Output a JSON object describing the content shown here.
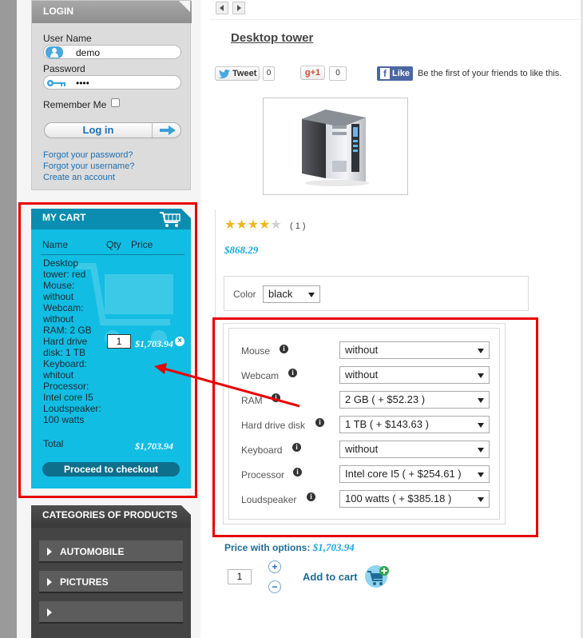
{
  "login": {
    "title": "LOGIN",
    "username_label": "User Name",
    "username_value": "demo",
    "password_label": "Password",
    "password_value": "••••",
    "remember_label": "Remember Me",
    "login_button": "Log in",
    "forgot_password": "Forgot your password?",
    "forgot_username": "Forgot your username?",
    "create_account": "Create an account"
  },
  "cart": {
    "title": "MY CART",
    "col_name": "Name",
    "col_qty": "Qty",
    "col_price": "Price",
    "item_lines": [
      "Desktop",
      "tower: red",
      "Mouse:",
      "without",
      "Webcam:",
      "without",
      "RAM: 2 GB",
      "Hard drive",
      "disk: 1 TB",
      "Keyboard:",
      "whitout",
      "Processor:",
      "Intel core I5",
      "Loudspeaker:",
      "100 watts"
    ],
    "item_qty": "1",
    "item_price": "$1,703.94",
    "total_label": "Total",
    "total_value": "$1,703.94",
    "checkout_button": "Proceed to checkout"
  },
  "categories": {
    "title": "CATEGORIES OF PRODUCTS",
    "items": [
      "AUTOMOBILE",
      "PICTURES",
      ""
    ]
  },
  "product": {
    "title": "Desktop tower",
    "tweet_label": "Tweet",
    "tweet_count": "0",
    "gplus_label": "+1",
    "gplus_count": "0",
    "fb_like_label": "Like",
    "fb_text": "Be the first of your friends to like this.",
    "rating_stars": 4,
    "rating_count": "( 1 )",
    "price": "$868.29",
    "color_label": "Color",
    "color_value": "black",
    "options": [
      {
        "label": "Mouse",
        "value": "without"
      },
      {
        "label": "Webcam",
        "value": "without"
      },
      {
        "label": "RAM",
        "value": "2 GB ( + $52.23 )"
      },
      {
        "label": "Hard drive disk",
        "value": "1 TB ( + $143.63 )"
      },
      {
        "label": "Keyboard",
        "value": "without"
      },
      {
        "label": "Processor",
        "value": "Intel core I5 ( + $254.61 )"
      },
      {
        "label": "Loudspeaker",
        "value": "100 watts ( + $385.18 )"
      }
    ],
    "price_with_options_label": "Price with options:",
    "price_with_options_value": "$1,703.94",
    "quantity": "1",
    "add_to_cart": "Add to cart"
  },
  "colors": {
    "highlight_border": "#e80000",
    "cart_bg": "#11bde3",
    "accent_blue": "#1aa7d8"
  }
}
